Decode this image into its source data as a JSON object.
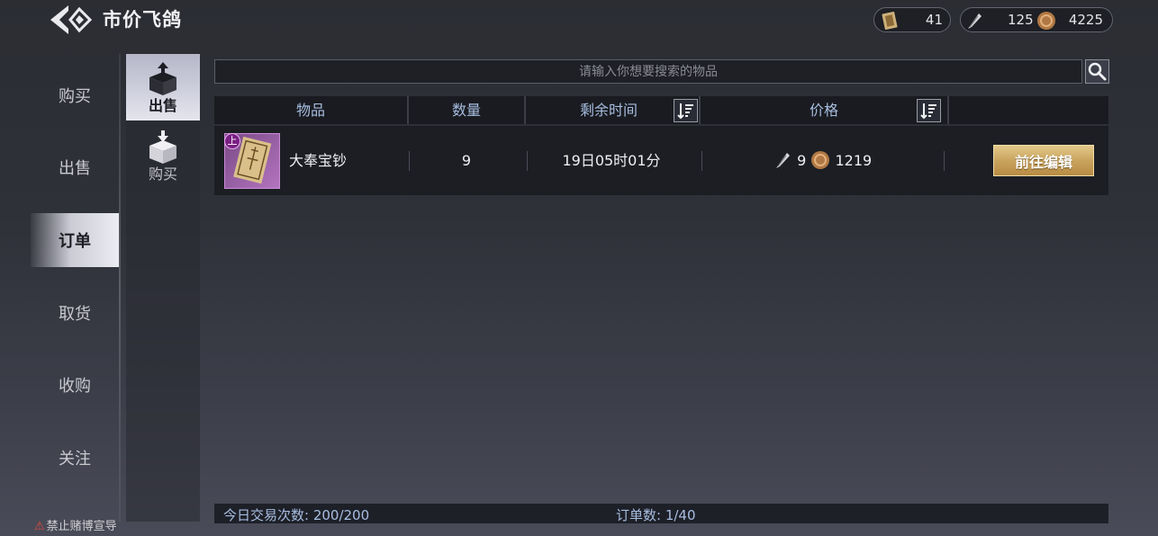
{
  "header": {
    "title": "市价飞鸽",
    "currencies": [
      {
        "icon": "scroll-ticket-icon",
        "value": "41"
      },
      {
        "icon": "feather-icon",
        "value": "125"
      },
      {
        "icon": "copper-coin-icon",
        "value": "4225"
      }
    ]
  },
  "nav": {
    "items": [
      {
        "label": "购买",
        "active": false
      },
      {
        "label": "出售",
        "active": false
      },
      {
        "label": "订单",
        "active": true
      },
      {
        "label": "取货",
        "active": false
      },
      {
        "label": "收购",
        "active": false
      },
      {
        "label": "关注",
        "active": false
      }
    ]
  },
  "subnav": {
    "items": [
      {
        "label": "出售",
        "icon": "box-up-icon",
        "active": true
      },
      {
        "label": "购买",
        "icon": "box-down-icon",
        "active": false
      }
    ]
  },
  "search": {
    "placeholder": "请输入你想要搜索的物品",
    "value": ""
  },
  "table": {
    "headers": {
      "item": "物品",
      "quantity": "数量",
      "remaining": "剩余时间",
      "price": "价格"
    },
    "rows": [
      {
        "tag": "上",
        "name": "大奉宝钞",
        "quantity": "9",
        "remaining": "19日05时01分",
        "price_feather": "9",
        "price_coin": "1219",
        "action": "前往编辑"
      }
    ]
  },
  "footer": {
    "trades_today": "今日交易次数: 200/200",
    "orders": "订单数: 1/40"
  },
  "warning": "禁止赌博宣导",
  "colors": {
    "accent_gold": "#c9a45e",
    "header_text": "#a7bde0",
    "warning_red": "#e04a3c"
  }
}
